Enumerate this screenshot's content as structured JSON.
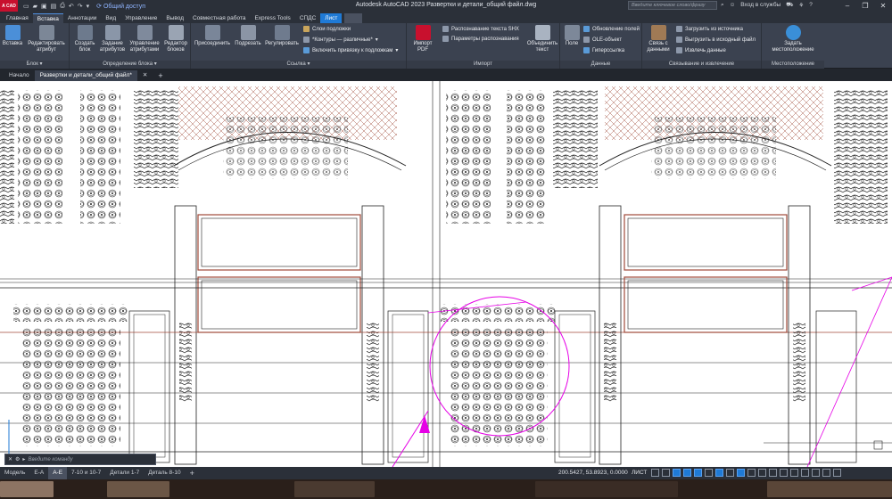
{
  "app": {
    "logo": "A CAD",
    "title": "Autodesk AutoCAD 2023    Развертки и детали_общий файл.dwg",
    "share_label": "Общий доступ",
    "search_placeholder": "Введите ключевое слово/фразу",
    "signin_label": "Вход в службы",
    "window_controls": [
      "minimize-icon",
      "restore-icon",
      "close-icon"
    ]
  },
  "ribbon_tabs": [
    "Главная",
    "Вставка",
    "Аннотации",
    "Вид",
    "Управление",
    "Вывод",
    "Совместная работа",
    "Express Tools",
    "СПДС",
    "Лист"
  ],
  "active_ribbon_tab": "Вставка",
  "ribbon": {
    "block_panel": {
      "title": "Блок ▾",
      "insert": "Вставка",
      "edit_attr": "Редактировать атрибут"
    },
    "block_def_panel": {
      "title": "Определение блока ▾",
      "create": "Создать блок",
      "attr_def": "Задание атрибутов",
      "manage_attr": "Управление атрибутами",
      "block_editor": "Редактор блоков"
    },
    "reference_panel": {
      "title": "Ссылка ▾",
      "attach": "Присоединить",
      "clip": "Подрезать",
      "adjust": "Регулировать",
      "underlay_layers": "Слои подложки",
      "frames": "*Контуры — различные*",
      "snap_underlays": "Включить привязку к подложкам"
    },
    "import_panel": {
      "title": "Импорт",
      "import_pdf": "Импорт PDF",
      "shx_recog": "Распознавание текста SHX",
      "recog_params": "Параметры распознавания",
      "combine_text": "Объединить текст"
    },
    "data_panel": {
      "title": "Данные",
      "field": "Поле",
      "update_fields": "Обновление полей",
      "ole_object": "OLE-объект",
      "hyperlink": "Гиперссылка"
    },
    "linking_panel": {
      "title": "Связывание и извлечение",
      "data_link": "Связь с данными",
      "download_source": "Загрузить из источника",
      "upload_source": "Выгрузить в исходный файл",
      "extract_data": "Извлечь данные"
    },
    "location_panel": {
      "title": "Местоположение",
      "set_location": "Задать местоположение"
    }
  },
  "doc_tabs": [
    "Начало",
    "Развертки и детали_общий файл*"
  ],
  "active_doc_tab": "Развертки и детали_общий файл*",
  "command_line": {
    "placeholder": "Введите команду"
  },
  "layout_tabs": [
    "Модель",
    "Е-А",
    "А-Е",
    "7-10 и 10-7",
    "Детали 1-7",
    "Деталь 8-10"
  ],
  "active_layout_tab": "А-Е",
  "status": {
    "coords": "200.5427, 53.8923, 0.0000",
    "space": "ЛИСТ"
  },
  "colors": {
    "accent": "#1f7ad6",
    "ribbon_bg": "#3b4250",
    "titlebar_bg": "#2b3039",
    "canvas_bg": "#ffffff",
    "selection_magenta": "#e600e6",
    "hatch_brown": "#a04a3a"
  }
}
